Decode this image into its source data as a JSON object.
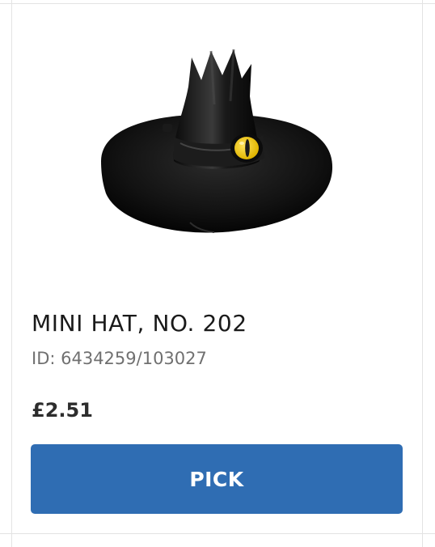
{
  "product": {
    "name": "MINI HAT, NO. 202",
    "id_text": "ID: 6434259/103027",
    "price": "£2.51",
    "image_icon": "witch-hat-icon"
  },
  "actions": {
    "pick_label": "PICK"
  },
  "colors": {
    "button": "#2f6db3",
    "hat": "#111111",
    "eye": "#f3cf1e"
  }
}
